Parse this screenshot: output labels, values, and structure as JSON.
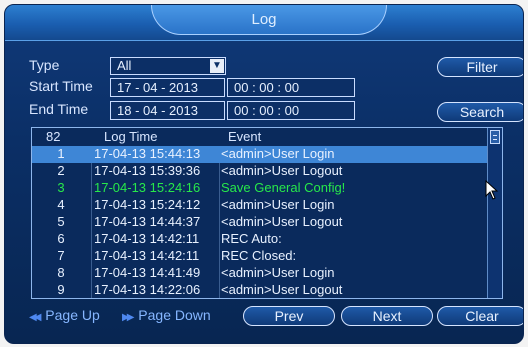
{
  "window": {
    "title": "Log"
  },
  "filters": {
    "type_label": "Type",
    "type_value": "All",
    "start_label": "Start Time",
    "start_date": "17 - 04 - 2013",
    "start_time": "00 : 00 : 00",
    "end_label": "End Time",
    "end_date": "18 - 04 - 2013",
    "end_time": "00 : 00 : 00"
  },
  "buttons": {
    "filter": "Filter",
    "search": "Search",
    "prev": "Prev",
    "next": "Next",
    "clear": "Clear"
  },
  "table": {
    "count_header": "82",
    "time_header": "Log Time",
    "event_header": "Event",
    "rows": [
      {
        "num": "1",
        "time": "17-04-13 15:44:13",
        "event": "<admin>User Login",
        "state": "selected"
      },
      {
        "num": "2",
        "time": "17-04-13 15:39:36",
        "event": "<admin>User Logout",
        "state": "normal"
      },
      {
        "num": "3",
        "time": "17-04-13 15:24:16",
        "event": "Save General Config!",
        "state": "highlight",
        "color": "#27e84a"
      },
      {
        "num": "4",
        "time": "17-04-13 15:24:12",
        "event": "<admin>User Login",
        "state": "normal"
      },
      {
        "num": "5",
        "time": "17-04-13 14:44:37",
        "event": "<admin>User Logout",
        "state": "normal"
      },
      {
        "num": "6",
        "time": "17-04-13 14:42:11",
        "event": "REC Auto:",
        "state": "normal"
      },
      {
        "num": "7",
        "time": "17-04-13 14:42:11",
        "event": "REC Closed:",
        "state": "normal"
      },
      {
        "num": "8",
        "time": "17-04-13 14:41:49",
        "event": "<admin>User Login",
        "state": "normal"
      },
      {
        "num": "9",
        "time": "17-04-13 14:22:06",
        "event": "<admin>User Logout",
        "state": "normal"
      }
    ]
  },
  "footer": {
    "page_up": "Page Up",
    "page_down": "Page Down"
  },
  "colors": {
    "selected_row": "#3e86d6",
    "highlight_text": "#27e84a",
    "background": "#0b2f66"
  }
}
